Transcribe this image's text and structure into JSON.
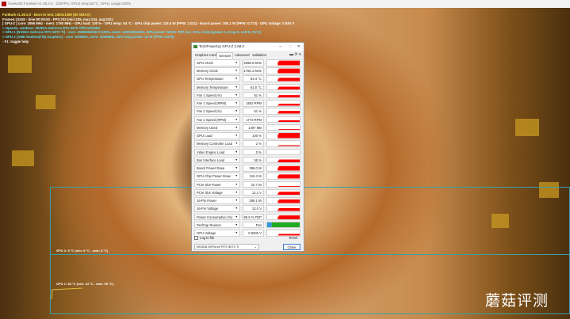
{
  "window": {
    "title": "Geeks3D FurMark v1.39.2.0 - 232FPS, GPU1 temp:65°C, GPU1 usage:100%"
  },
  "overlay": [
    {
      "text": "FurMark v1.39.2.0 - Burn-in test, 1920x1080 (8X MSAA)",
      "color": "y"
    },
    {
      "text": "Frames:12419 - time:00:00:53 - FPS:232 (min:235, max:234, avg:232)",
      "color": "w"
    },
    {
      "text": "[ GPU-Z ] core: 2595 MHz - mem: 1750 MHz - GPU load: 100 % - GPU temp: 64 °C - GPU chip power: 115.4 W (PPW: 2.011) - Board power: 300.1 W (PPW: 0.773) - GPU voltage: 0.930 V",
      "color": "w"
    },
    {
      "text": "> OpenGL renderer: NVIDIA GeForce RTX 5070 Ti/PCIe/SSE2",
      "color": "c"
    },
    {
      "text": "> GPU 1 (NVIDIA GeForce RTX 5070 Ti) - core: 2595MHz/65°C/100%, mem: 14001MHz/9%, GPU power: 99.9% TDP, fan: 51%, limits:[power:1, temp:0, volt:0, OV:0]",
      "color": "c"
    },
    {
      "text": "> GPU 2 (AMD Radeon(TM) Graphics) - core: 600MHz, mem: 3000MHz, GPU chip power: 15 W (PPW: 6.579)",
      "color": "c"
    },
    {
      "text": "- F1: toggle help",
      "color": "w"
    }
  ],
  "gpuz": {
    "title": "TechPowerUp GPU-Z 2.68.0",
    "tabs": [
      "Graphics Card",
      "Sensors",
      "Advanced",
      "Validation"
    ],
    "active_tab": "Sensors",
    "sensors": [
      {
        "label": "GPU Clock",
        "value": "2595.0 MHz",
        "level": 0.9
      },
      {
        "label": "Memory Clock",
        "value": "1750.1 MHz",
        "level": 0.9
      },
      {
        "label": "GPU Temperature",
        "value": "64.4 °C",
        "level": 0.6
      },
      {
        "label": "Memory Temperature",
        "value": "62.0 °C",
        "level": 0.55
      },
      {
        "label": "Fan 1 Speed (%)",
        "value": "51 %",
        "level": 0.45
      },
      {
        "label": "Fan 1 Speed (RPM)",
        "value": "1552 RPM",
        "level": 0.3
      },
      {
        "label": "Fan 2 Speed (%)",
        "value": "51 %",
        "level": 0.45
      },
      {
        "label": "Fan 2 Speed (RPM)",
        "value": "1772 RPM",
        "level": 0.3
      },
      {
        "label": "Memory Used",
        "value": "1497 MB",
        "level": 0.1
      },
      {
        "label": "GPU Load",
        "value": "100 %",
        "level": 1.0
      },
      {
        "label": "Memory Controller Load",
        "value": "2 %",
        "level": 0.05
      },
      {
        "label": "Video Engine Load",
        "value": "0 %",
        "level": 0
      },
      {
        "label": "Bus Interface Load",
        "value": "55 %",
        "level": 0.55
      },
      {
        "label": "Board Power Draw",
        "value": "299.0 W",
        "level": 0.85
      },
      {
        "label": "GPU Chip Power Draw",
        "value": "115.3 W",
        "level": 0.75
      },
      {
        "label": "PCIe Slot Power",
        "value": "10.7 W",
        "level": 0.1
      },
      {
        "label": "PCIe Slot Voltage",
        "value": "12.1 V",
        "level": 0.6
      },
      {
        "label": "16-Pin Power",
        "value": "289.1 W",
        "level": 0.65
      },
      {
        "label": "16-Pin Voltage",
        "value": "12.0 V",
        "level": 0.5
      },
      {
        "label": "Power Consumption (%)",
        "value": "99.9 % TDP",
        "level": 0.8
      },
      {
        "label": "PerfCap Reason",
        "value": "Pwr",
        "level": 1.0,
        "color": "#22aa22"
      },
      {
        "label": "GPU Voltage",
        "value": "0.9300 V",
        "level": 0.2
      }
    ],
    "log_label": "Log to file",
    "reset_label": "Reset",
    "gpu_select": "NVIDIA GeForce RTX 5070 Ti",
    "close_label": "Close",
    "graph_color": "#ff0000"
  },
  "graphs": {
    "gpu2": "GPU 2: 8 °C (min: 8 °C - max: 8 °C)",
    "gpu1": "GPU 1: 65 °C (min: 44 °C - max: 65 °C)"
  },
  "watermark": "蘑菇评测"
}
